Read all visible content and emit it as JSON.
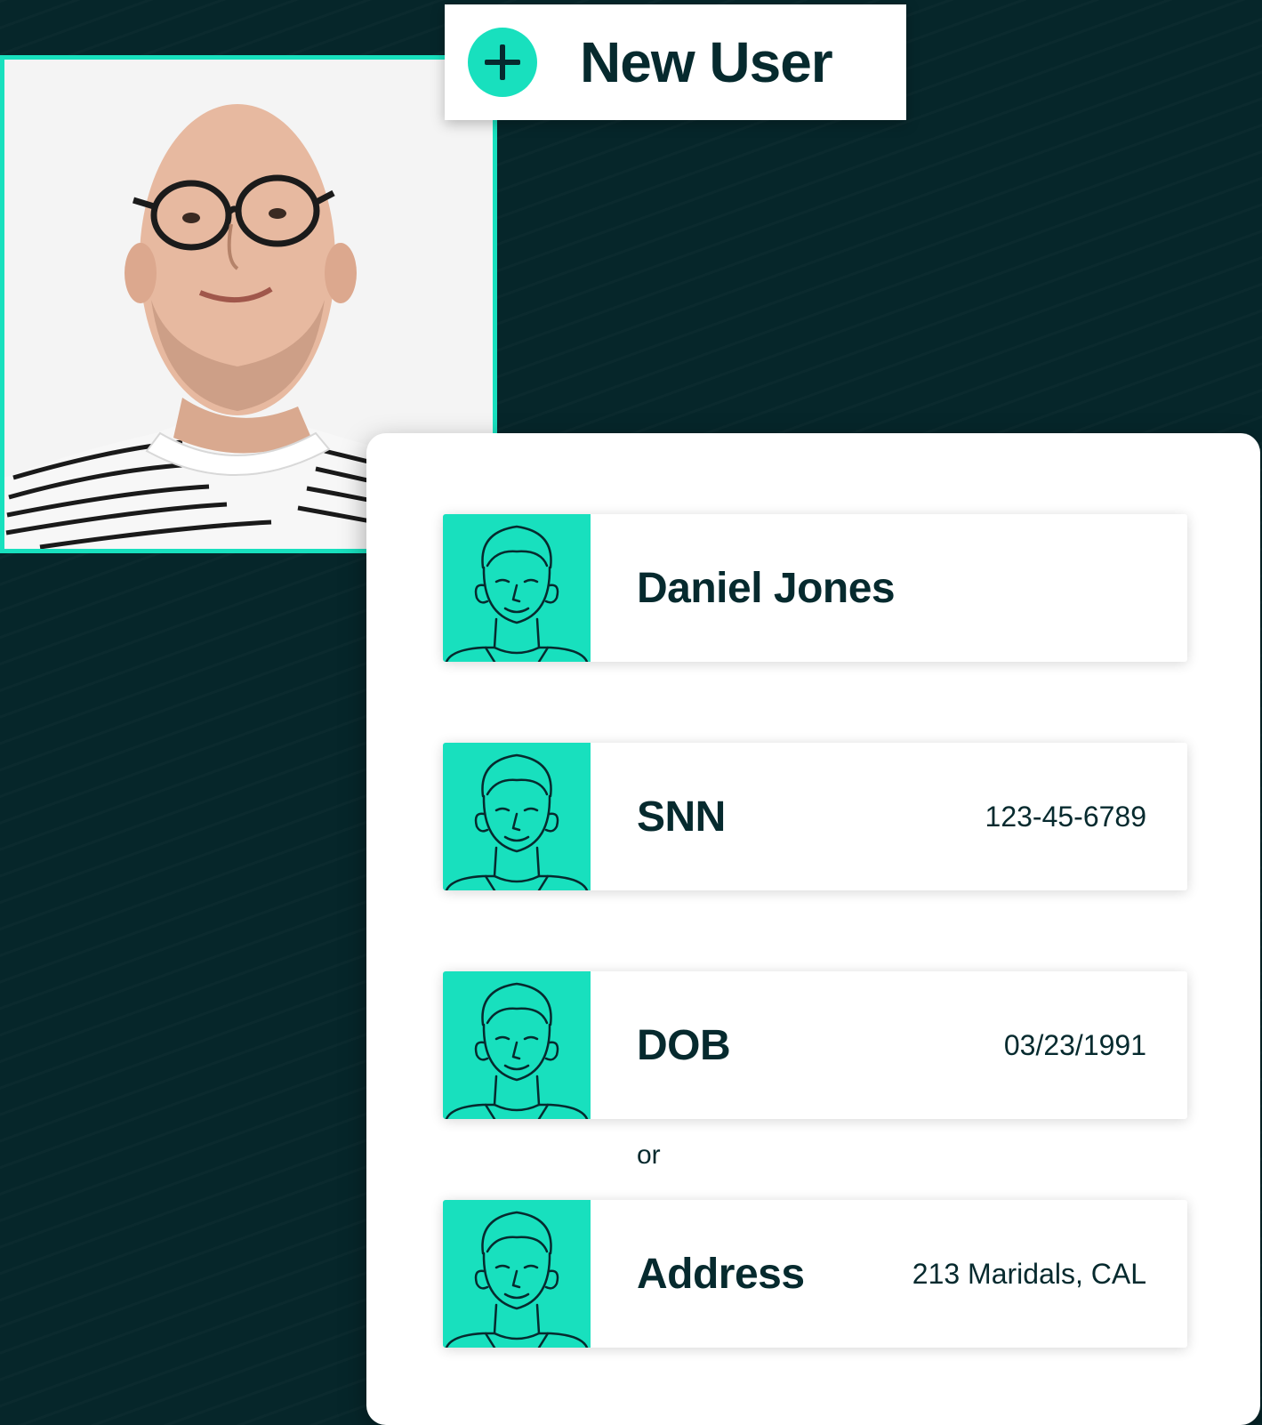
{
  "header": {
    "new_user_label": "New User"
  },
  "profile_photo": {
    "description_icon": "person-photo"
  },
  "form": {
    "fields": [
      {
        "label": "Daniel Jones",
        "value": ""
      },
      {
        "label": "SNN",
        "value": "123-45-6789"
      },
      {
        "label": "DOB",
        "value": "03/23/1991"
      },
      {
        "label": "Address",
        "value": "213 Maridals, CAL"
      }
    ],
    "separator_text": "or"
  },
  "colors": {
    "background": "#06262a",
    "accent": "#18e0be",
    "text_dark": "#062a2e",
    "card": "#ffffff"
  }
}
